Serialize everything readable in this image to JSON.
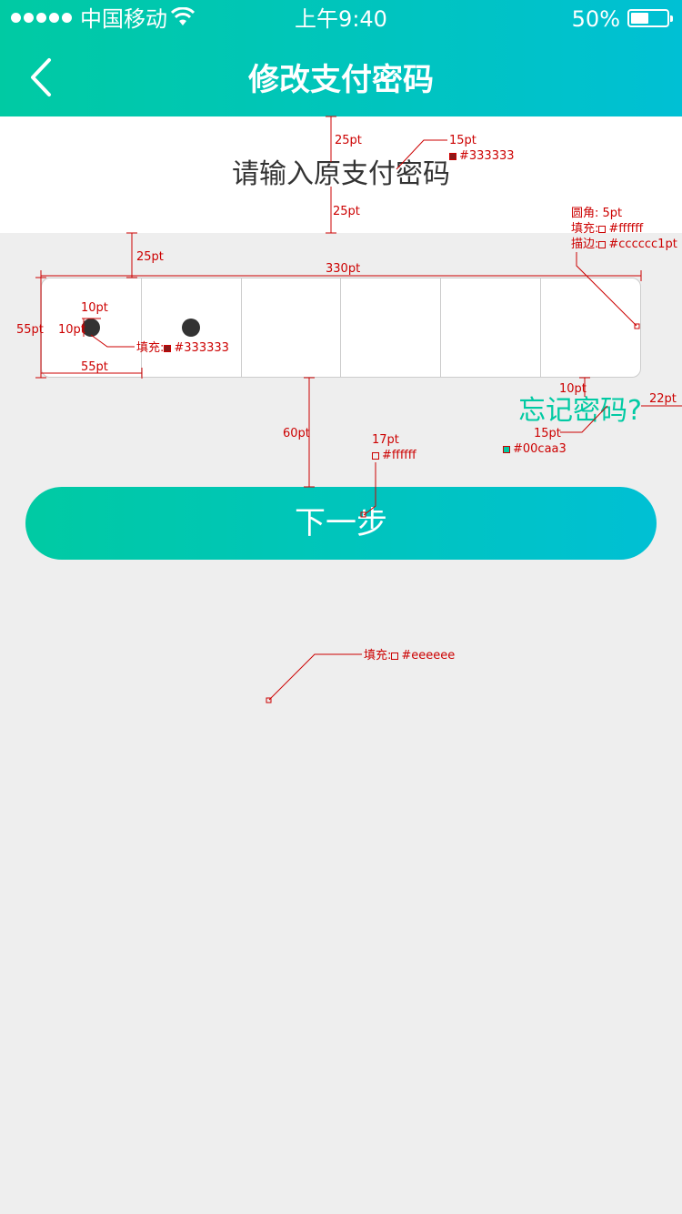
{
  "status_bar": {
    "carrier": "中国移动",
    "time": "上午9:40",
    "battery_percent": "50%",
    "battery_level": 0.5
  },
  "nav": {
    "title": "修改支付密码",
    "back_icon": "chevron-left-icon"
  },
  "prompt": {
    "text": "请输入原支付密码"
  },
  "password": {
    "length": 6,
    "filled": 2
  },
  "forgot_link": "忘记密码?",
  "next_button": "下一步",
  "colors": {
    "accent": "#00caa3",
    "gradient_end": "#00c0d4",
    "text_dark": "#333333",
    "border": "#cccccc",
    "background": "#eeeeee",
    "white": "#ffffff"
  },
  "annotations": {
    "spacing_25pt_a": "25pt",
    "spacing_25pt_b": "25pt",
    "spacing_25pt_c": "25pt",
    "font_15pt": "15pt",
    "color_333_text": "#333333",
    "box_width": "330pt",
    "box_height": "55pt",
    "cell_width": "55pt",
    "dot_width": "10pt",
    "dot_height": "10pt",
    "dot_fill_label": "填充:",
    "dot_fill_color": "#333333",
    "radius_label": "圆角: 5pt",
    "box_fill_label": "填充:",
    "box_fill_color": "#ffffff",
    "box_stroke_label": "描边:",
    "box_stroke_color": "#cccccc1pt",
    "forgot_top": "10pt",
    "forgot_right": "22pt",
    "forgot_font": "15pt",
    "forgot_color": "#00caa3",
    "button_gap": "60pt",
    "button_font": "17pt",
    "button_text_color": "#ffffff",
    "bg_fill_label": "填充:",
    "bg_fill_color": "#eeeeee"
  }
}
